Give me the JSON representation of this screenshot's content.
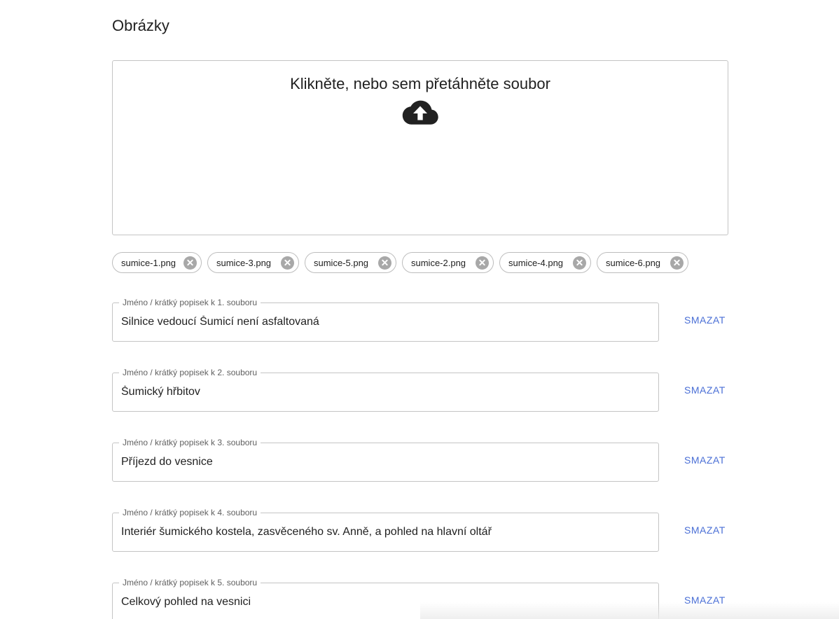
{
  "section": {
    "title": "Obrázky"
  },
  "dropzone": {
    "label": "Klikněte, nebo sem přetáhněte soubor",
    "icon": "cloud-upload-icon"
  },
  "files": [
    {
      "name": "sumice-1.png"
    },
    {
      "name": "sumice-3.png"
    },
    {
      "name": "sumice-5.png"
    },
    {
      "name": "sumice-2.png"
    },
    {
      "name": "sumice-4.png"
    },
    {
      "name": "sumice-6.png"
    }
  ],
  "captions": [
    {
      "label": "Jméno / krátký popisek k 1. souboru",
      "value": "Silnice vedoucí Šumicí není asfaltovaná",
      "delete_label": "SMAZAT"
    },
    {
      "label": "Jméno / krátký popisek k 2. souboru",
      "value": "Šumický hřbitov",
      "delete_label": "SMAZAT"
    },
    {
      "label": "Jméno / krátký popisek k 3. souboru",
      "value": "Příjezd do vesnice",
      "delete_label": "SMAZAT"
    },
    {
      "label": "Jméno / krátký popisek k 4. souboru",
      "value": "Interiér šumického kostela, zasvěceného sv. Anně, a pohled na hlavní oltář",
      "delete_label": "SMAZAT"
    },
    {
      "label": "Jméno / krátký popisek k 5. souboru",
      "value": "Celkový pohled na vesnici",
      "delete_label": "SMAZAT"
    }
  ],
  "colors": {
    "accent": "#4a6fd6",
    "border": "#c4c4c4",
    "text": "#212121"
  }
}
